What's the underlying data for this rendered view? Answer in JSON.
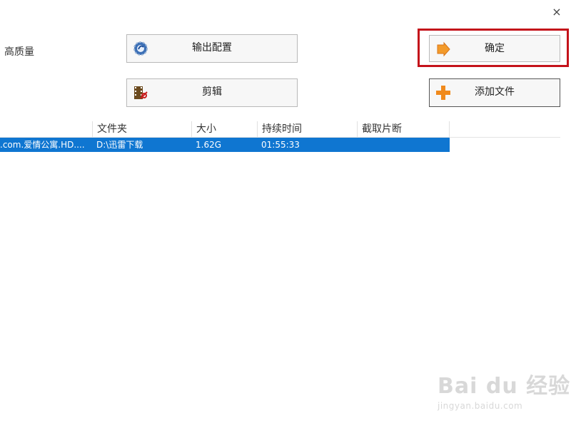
{
  "window": {
    "close_label": "×"
  },
  "quality_label": "高质量",
  "buttons": {
    "output_config": "输出配置",
    "edit": "剪辑",
    "confirm": "确定",
    "add_file": "添加文件"
  },
  "table": {
    "headers": [
      "文件夹",
      "大小",
      "持续时间",
      "截取片断"
    ],
    "rows": [
      {
        "name": ".com.爱情公寓.HD....",
        "folder": "D:\\迅雷下载",
        "size": "1.62G",
        "duration": "01:55:33",
        "clip": ""
      }
    ]
  },
  "watermark": {
    "logo": "Bai du 经验",
    "url": "jingyan.baidu.com"
  },
  "colors": {
    "selection": "#0f76d1",
    "highlight_border": "#c4121a",
    "add_icon": "#f08a1c",
    "confirm_icon": "#f39a2a"
  }
}
